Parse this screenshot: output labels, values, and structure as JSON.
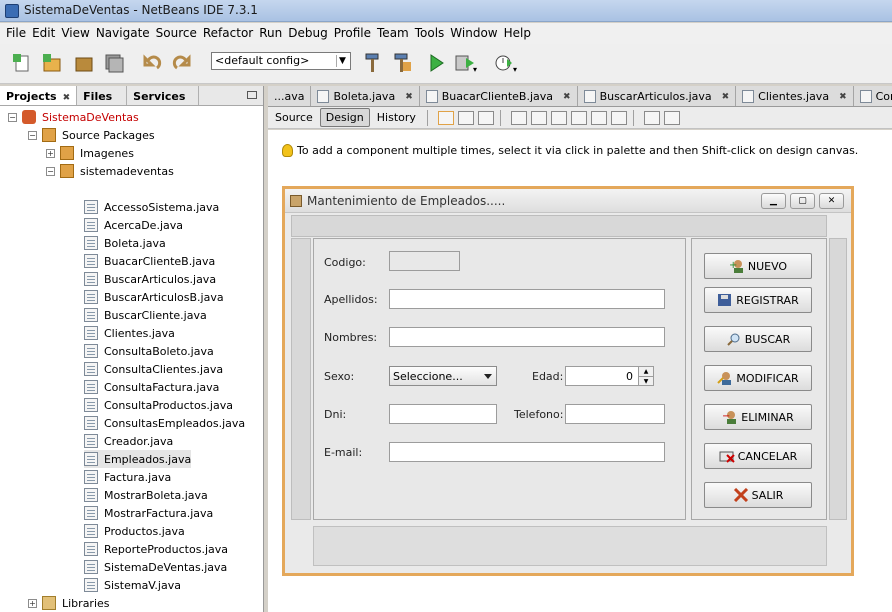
{
  "window": {
    "title": "SistemaDeVentas - NetBeans IDE 7.3.1"
  },
  "menu": [
    "File",
    "Edit",
    "View",
    "Navigate",
    "Source",
    "Refactor",
    "Run",
    "Debug",
    "Profile",
    "Team",
    "Tools",
    "Window",
    "Help"
  ],
  "toolbar": {
    "config": "<default config>"
  },
  "left_panel": {
    "tabs": [
      "Projects",
      "Files",
      "Services"
    ],
    "tree": {
      "project": "SistemaDeVentas",
      "source_packages": "Source Packages",
      "imagenes": "Imagenes",
      "package": "sistemadeventas",
      "files": [
        "AccessoSistema.java",
        "AcercaDe.java",
        "Boleta.java",
        "BuacarClienteB.java",
        "BuscarArticulos.java",
        "BuscarArticulosB.java",
        "BuscarCliente.java",
        "Clientes.java",
        "ConsultaBoleto.java",
        "ConsultaClientes.java",
        "ConsultaFactura.java",
        "ConsultaProductos.java",
        "ConsultasEmpleados.java",
        "Creador.java",
        "Empleados.java",
        "Factura.java",
        "MostrarBoleta.java",
        "MostrarFactura.java",
        "Productos.java",
        "ReporteProductos.java",
        "SistemaDeVentas.java",
        "SistemaV.java"
      ],
      "libraries": "Libraries"
    }
  },
  "editor_tabs": [
    "...ava",
    "Boleta.java",
    "BuacarClienteB.java",
    "BuscarArticulos.java",
    "Clientes.java",
    "ConsultaBole"
  ],
  "design_toolbar": {
    "source": "Source",
    "design": "Design",
    "history": "History"
  },
  "hint": "To add a component multiple times, select it via click in palette and then Shift-click on design canvas.",
  "form": {
    "title": "Mantenimiento de Empleados.....",
    "labels": {
      "codigo": "Codigo:",
      "apellidos": "Apellidos:",
      "nombres": "Nombres:",
      "sexo": "Sexo:",
      "edad": "Edad:",
      "dni": "Dni:",
      "telefono": "Telefono:",
      "email": "E-mail:"
    },
    "sexo_selected": "Seleccione...",
    "edad_value": "0",
    "buttons": {
      "nuevo": "NUEVO",
      "registrar": "REGISTRAR",
      "buscar": "BUSCAR",
      "modificar": "MODIFICAR",
      "eliminar": "ELIMINAR",
      "cancelar": "CANCELAR",
      "salir": "SALIR"
    }
  }
}
